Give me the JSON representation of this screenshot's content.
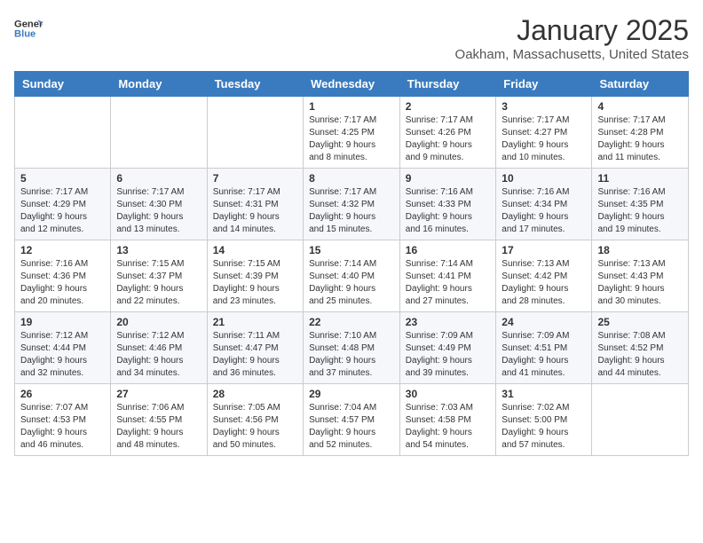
{
  "header": {
    "logo_general": "General",
    "logo_blue": "Blue",
    "month_title": "January 2025",
    "location": "Oakham, Massachusetts, United States"
  },
  "weekdays": [
    "Sunday",
    "Monday",
    "Tuesday",
    "Wednesday",
    "Thursday",
    "Friday",
    "Saturday"
  ],
  "weeks": [
    [
      {
        "day": "",
        "info": ""
      },
      {
        "day": "",
        "info": ""
      },
      {
        "day": "",
        "info": ""
      },
      {
        "day": "1",
        "info": "Sunrise: 7:17 AM\nSunset: 4:25 PM\nDaylight: 9 hours\nand 8 minutes."
      },
      {
        "day": "2",
        "info": "Sunrise: 7:17 AM\nSunset: 4:26 PM\nDaylight: 9 hours\nand 9 minutes."
      },
      {
        "day": "3",
        "info": "Sunrise: 7:17 AM\nSunset: 4:27 PM\nDaylight: 9 hours\nand 10 minutes."
      },
      {
        "day": "4",
        "info": "Sunrise: 7:17 AM\nSunset: 4:28 PM\nDaylight: 9 hours\nand 11 minutes."
      }
    ],
    [
      {
        "day": "5",
        "info": "Sunrise: 7:17 AM\nSunset: 4:29 PM\nDaylight: 9 hours\nand 12 minutes."
      },
      {
        "day": "6",
        "info": "Sunrise: 7:17 AM\nSunset: 4:30 PM\nDaylight: 9 hours\nand 13 minutes."
      },
      {
        "day": "7",
        "info": "Sunrise: 7:17 AM\nSunset: 4:31 PM\nDaylight: 9 hours\nand 14 minutes."
      },
      {
        "day": "8",
        "info": "Sunrise: 7:17 AM\nSunset: 4:32 PM\nDaylight: 9 hours\nand 15 minutes."
      },
      {
        "day": "9",
        "info": "Sunrise: 7:16 AM\nSunset: 4:33 PM\nDaylight: 9 hours\nand 16 minutes."
      },
      {
        "day": "10",
        "info": "Sunrise: 7:16 AM\nSunset: 4:34 PM\nDaylight: 9 hours\nand 17 minutes."
      },
      {
        "day": "11",
        "info": "Sunrise: 7:16 AM\nSunset: 4:35 PM\nDaylight: 9 hours\nand 19 minutes."
      }
    ],
    [
      {
        "day": "12",
        "info": "Sunrise: 7:16 AM\nSunset: 4:36 PM\nDaylight: 9 hours\nand 20 minutes."
      },
      {
        "day": "13",
        "info": "Sunrise: 7:15 AM\nSunset: 4:37 PM\nDaylight: 9 hours\nand 22 minutes."
      },
      {
        "day": "14",
        "info": "Sunrise: 7:15 AM\nSunset: 4:39 PM\nDaylight: 9 hours\nand 23 minutes."
      },
      {
        "day": "15",
        "info": "Sunrise: 7:14 AM\nSunset: 4:40 PM\nDaylight: 9 hours\nand 25 minutes."
      },
      {
        "day": "16",
        "info": "Sunrise: 7:14 AM\nSunset: 4:41 PM\nDaylight: 9 hours\nand 27 minutes."
      },
      {
        "day": "17",
        "info": "Sunrise: 7:13 AM\nSunset: 4:42 PM\nDaylight: 9 hours\nand 28 minutes."
      },
      {
        "day": "18",
        "info": "Sunrise: 7:13 AM\nSunset: 4:43 PM\nDaylight: 9 hours\nand 30 minutes."
      }
    ],
    [
      {
        "day": "19",
        "info": "Sunrise: 7:12 AM\nSunset: 4:44 PM\nDaylight: 9 hours\nand 32 minutes."
      },
      {
        "day": "20",
        "info": "Sunrise: 7:12 AM\nSunset: 4:46 PM\nDaylight: 9 hours\nand 34 minutes."
      },
      {
        "day": "21",
        "info": "Sunrise: 7:11 AM\nSunset: 4:47 PM\nDaylight: 9 hours\nand 36 minutes."
      },
      {
        "day": "22",
        "info": "Sunrise: 7:10 AM\nSunset: 4:48 PM\nDaylight: 9 hours\nand 37 minutes."
      },
      {
        "day": "23",
        "info": "Sunrise: 7:09 AM\nSunset: 4:49 PM\nDaylight: 9 hours\nand 39 minutes."
      },
      {
        "day": "24",
        "info": "Sunrise: 7:09 AM\nSunset: 4:51 PM\nDaylight: 9 hours\nand 41 minutes."
      },
      {
        "day": "25",
        "info": "Sunrise: 7:08 AM\nSunset: 4:52 PM\nDaylight: 9 hours\nand 44 minutes."
      }
    ],
    [
      {
        "day": "26",
        "info": "Sunrise: 7:07 AM\nSunset: 4:53 PM\nDaylight: 9 hours\nand 46 minutes."
      },
      {
        "day": "27",
        "info": "Sunrise: 7:06 AM\nSunset: 4:55 PM\nDaylight: 9 hours\nand 48 minutes."
      },
      {
        "day": "28",
        "info": "Sunrise: 7:05 AM\nSunset: 4:56 PM\nDaylight: 9 hours\nand 50 minutes."
      },
      {
        "day": "29",
        "info": "Sunrise: 7:04 AM\nSunset: 4:57 PM\nDaylight: 9 hours\nand 52 minutes."
      },
      {
        "day": "30",
        "info": "Sunrise: 7:03 AM\nSunset: 4:58 PM\nDaylight: 9 hours\nand 54 minutes."
      },
      {
        "day": "31",
        "info": "Sunrise: 7:02 AM\nSunset: 5:00 PM\nDaylight: 9 hours\nand 57 minutes."
      },
      {
        "day": "",
        "info": ""
      }
    ]
  ]
}
